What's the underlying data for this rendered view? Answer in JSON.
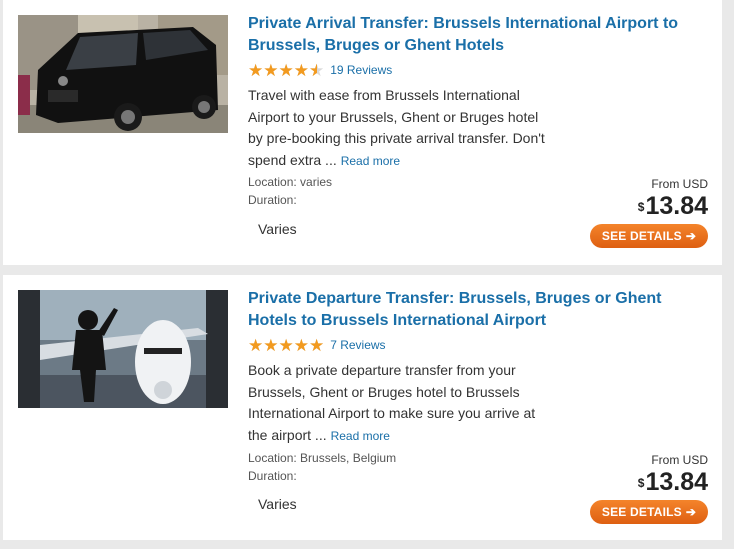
{
  "tours": [
    {
      "title": "Private Arrival Transfer: Brussels International Airport to Brussels, Bruges or Ghent Hotels",
      "rating": 4.5,
      "reviews": "19 Reviews",
      "description": "Travel with ease from Brussels International Airport to your Brussels, Ghent or Bruges hotel by pre-booking this private arrival transfer. Don't spend extra ...",
      "read_more": "Read more",
      "location": "Location: varies",
      "duration": "Duration:",
      "duration_value": "Varies",
      "from_label": "From USD",
      "currency_symbol": "$",
      "price": "13.84",
      "button": "SEE DETAILS",
      "image": "black-minivan-photo"
    },
    {
      "title": "Private Departure Transfer: Brussels, Bruges or Ghent Hotels to Brussels International Airport",
      "rating": 5,
      "reviews": "7 Reviews",
      "description": "Book a private departure transfer from your Brussels, Ghent or Bruges hotel to Brussels International Airport to make sure you arrive at the airport ...",
      "read_more": "Read more",
      "location": "Location: Brussels, Belgium",
      "duration": "Duration:",
      "duration_value": "Varies",
      "from_label": "From USD",
      "currency_symbol": "$",
      "price": "13.84",
      "button": "SEE DETAILS",
      "image": "child-watching-airplane-photo"
    }
  ],
  "icons": {
    "star": "star-icon",
    "button_arrow": "arrow-right-icon"
  },
  "colors": {
    "link": "#1a6fa8",
    "star": "#f29a1f",
    "button": "#e8701d"
  }
}
